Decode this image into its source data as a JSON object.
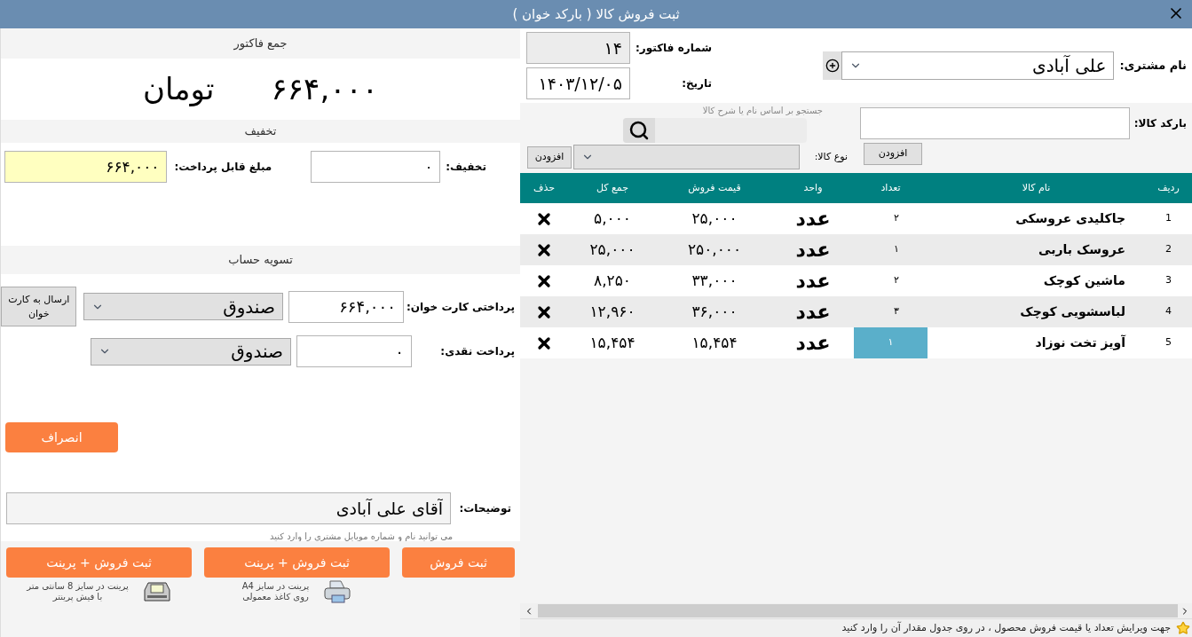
{
  "window": {
    "title": "ثبت فروش کالا ( بارکد خوان )"
  },
  "summary": {
    "heading": "جمع فاکتور",
    "total": "۶۶۴,۰۰۰",
    "currency": "تومان"
  },
  "discount": {
    "heading": "تخفیف",
    "label": "تخفیف:",
    "value": "۰",
    "payable_label": "مبلغ قابل پرداخت:",
    "payable_value": "۶۶۴,۰۰۰"
  },
  "settlement": {
    "heading": "تسویه حساب",
    "rows": [
      {
        "label": "پرداختی کارت خوان:",
        "value": "۶۶۴,۰۰۰",
        "account": "صندوق",
        "button": "ارسال به کارت خوان"
      },
      {
        "label": "پرداخت نقدی:",
        "value": "۰",
        "account": "صندوق"
      }
    ]
  },
  "cancel_button": "انصراف",
  "notes": {
    "label": "توضیحات:",
    "value": "آقای علی آبادی",
    "hint": "می توانید نام و شماره موبایل مشتری را وارد کنید"
  },
  "actions": [
    {
      "label": "ثبت فروش"
    },
    {
      "label": "ثبت فروش + پرینت",
      "caption": "پرینت در سایز A4\nروی کاغذ معمولی",
      "kind": "inkjet"
    },
    {
      "label": "ثبت فروش + پرینت",
      "caption": "پرینت در سایز 8 سانتی متر\nبا فیش پرینتر",
      "kind": "receipt"
    }
  ],
  "customer": {
    "label": "نام مشتری:",
    "value": "علی آبادی"
  },
  "invoice": {
    "number_label": "شماره فاکتور:",
    "number": "۱۴",
    "date_label": "تاریخ:",
    "date": "۱۴۰۳/۱۲/۰۵"
  },
  "barcode": {
    "label": "بارکد کالا:",
    "button": "افزودن"
  },
  "search": {
    "hint": "جستجو بر اساس نام یا شرح کالا"
  },
  "category": {
    "label": "نوع کالا:",
    "button": "افزودن"
  },
  "table": {
    "columns": [
      "ردیف",
      "نام کالا",
      "تعداد",
      "واحد",
      "قیمت فروش",
      "جمع کل",
      "حذف"
    ],
    "rows": [
      {
        "index": "1",
        "name": "جاکلیدی عروسکی",
        "qty": "۲",
        "unit": "عدد",
        "price": "۲۵,۰۰۰",
        "total": "۵,۰۰۰",
        "selected": false
      },
      {
        "index": "2",
        "name": "عروسک باربی",
        "qty": "۱",
        "unit": "عدد",
        "price": "۲۵۰,۰۰۰",
        "total": "۲۵,۰۰۰",
        "selected": false
      },
      {
        "index": "3",
        "name": "ماشین کوچک",
        "qty": "۲",
        "unit": "عدد",
        "price": "۳۳,۰۰۰",
        "total": "۸,۲۵۰",
        "selected": false
      },
      {
        "index": "4",
        "name": "لباسشویی کوچک",
        "qty": "۳",
        "unit": "عدد",
        "price": "۳۶,۰۰۰",
        "total": "۱۲,۹۶۰",
        "selected": false
      },
      {
        "index": "5",
        "name": "آویز تخت نوزاد",
        "qty": "۱",
        "unit": "عدد",
        "price": "۱۵,۴۵۴",
        "total": "۱۵,۴۵۴",
        "selected": true
      }
    ]
  },
  "status_bar": {
    "text": "جهت ویرایش تعداد یا قیمت فروش محصول ، در روی جدول مقدار آن را وارد کنید"
  }
}
